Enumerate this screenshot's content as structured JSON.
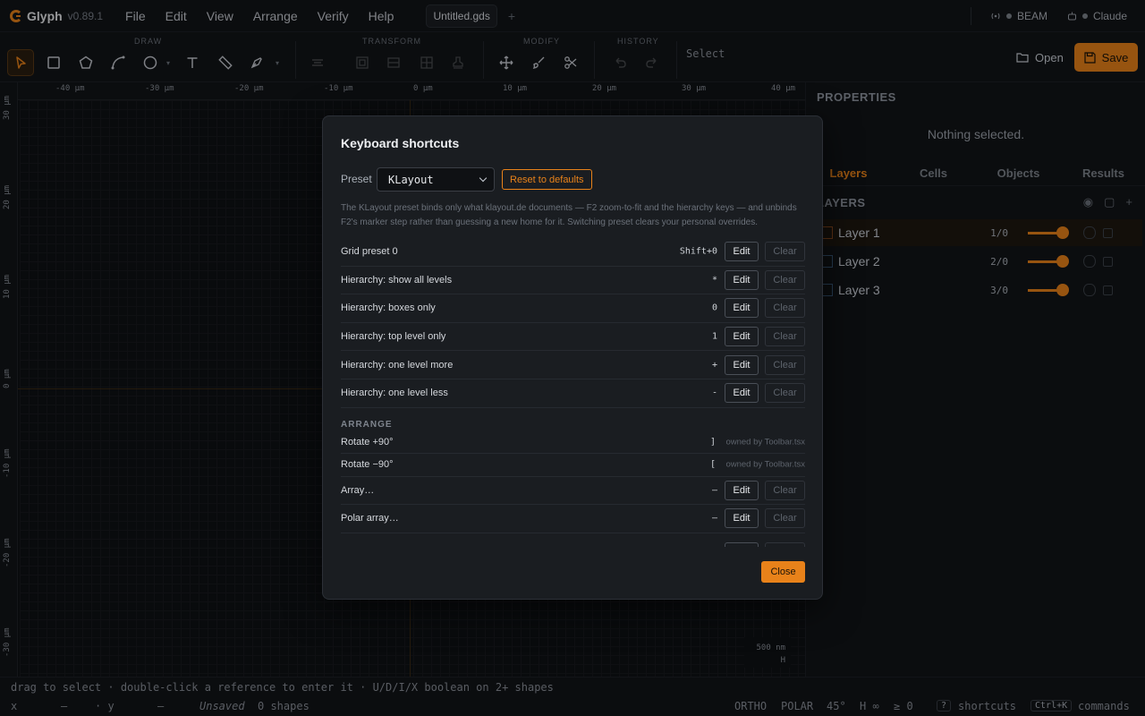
{
  "app": {
    "name": "Glyph",
    "version": "v0.89.1"
  },
  "menu": [
    "File",
    "Edit",
    "View",
    "Arrange",
    "Verify",
    "Help"
  ],
  "doc_tab": "Untitled.gds",
  "tab_plus": "+",
  "menubar_right": {
    "beam": "BEAM",
    "claude": "Claude"
  },
  "toolbar": {
    "groups": {
      "draw": "DRAW",
      "transform": "TRANSFORM",
      "modify": "MODIFY",
      "history": "HISTORY"
    },
    "mode": "Select",
    "open": "Open",
    "save": "Save"
  },
  "rulers": {
    "h": [
      "-40 µm",
      "-30 µm",
      "-20 µm",
      "-10 µm",
      "0 µm",
      "10 µm",
      "20 µm",
      "30 µm",
      "40 µm"
    ],
    "v": [
      "30 µm",
      "20 µm",
      "10 µm",
      "0 µm",
      "-10 µm",
      "-20 µm",
      "-30 µm"
    ]
  },
  "scale": {
    "value": "500 nm",
    "axis": "H"
  },
  "panel": {
    "title": "PROPERTIES",
    "empty": "Nothing selected.",
    "tabs": [
      "Layers",
      "Cells",
      "Objects",
      "Results"
    ],
    "layers_title": "LAYERS",
    "layers": [
      {
        "name": "Layer 1",
        "num": "1/0"
      },
      {
        "name": "Layer 2",
        "num": "2/0"
      },
      {
        "name": "Layer 3",
        "num": "3/0"
      }
    ]
  },
  "hint": "drag to select · double-click a reference to enter it · U/D/I/X boolean on 2+ shapes",
  "status": {
    "x": "x",
    "x_val": "—",
    "y": "· y",
    "y_val": "—",
    "saved": "Unsaved",
    "shapes": "0 shapes",
    "ortho": "ORTHO",
    "polar": "POLAR",
    "angle": "45°",
    "h": "H ∞",
    "ge": "≥ 0",
    "q": "?",
    "shortcuts": "shortcuts",
    "ctrlk": "Ctrl+K",
    "commands": "commands"
  },
  "modal": {
    "title": "Keyboard shortcuts",
    "preset_label": "Preset",
    "preset_value": "KLayout",
    "reset": "Reset to defaults",
    "description": "The KLayout preset binds only what klayout.de documents — F2 zoom-to-fit and the hierarchy keys — and unbinds F2's marker step rather than guessing a new home for it. Switching preset clears your personal overrides.",
    "edit": "Edit",
    "clear": "Clear",
    "rows": [
      {
        "label": "Grid preset 0",
        "key": "Shift+0"
      },
      {
        "label": "Hierarchy: show all levels",
        "key": "*"
      },
      {
        "label": "Hierarchy: boxes only",
        "key": "0"
      },
      {
        "label": "Hierarchy: top level only",
        "key": "1"
      },
      {
        "label": "Hierarchy: one level more",
        "key": "+"
      },
      {
        "label": "Hierarchy: one level less",
        "key": "-"
      }
    ],
    "arrange_section": "ARRANGE",
    "arrange_rows": [
      {
        "label": "Rotate +90°",
        "key": "]",
        "owned": "owned by Toolbar.tsx"
      },
      {
        "label": "Rotate −90°",
        "key": "[",
        "owned": "owned by Toolbar.tsx"
      },
      {
        "label": "Array…",
        "key": "—"
      },
      {
        "label": "Polar array…",
        "key": "—"
      }
    ],
    "close": "Close"
  }
}
